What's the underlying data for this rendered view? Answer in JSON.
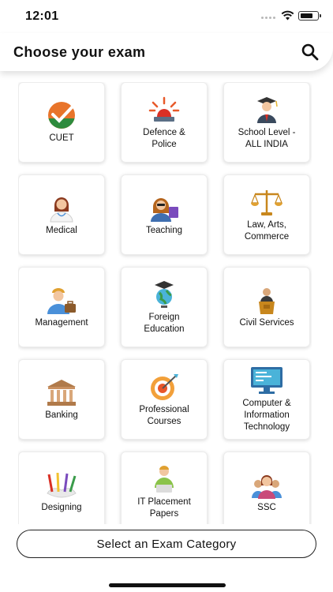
{
  "status_bar": {
    "time": "12:01"
  },
  "header": {
    "title": "Choose your exam",
    "search_icon": "search-icon"
  },
  "categories": [
    {
      "label": "CUET",
      "icon": "cuet-logo-icon"
    },
    {
      "label": "Defence &\nPolice",
      "icon": "siren-icon"
    },
    {
      "label": "School Level -\nALL INDIA",
      "icon": "graduate-icon"
    },
    {
      "label": "Medical",
      "icon": "doctor-icon"
    },
    {
      "label": "Teaching",
      "icon": "teacher-icon"
    },
    {
      "label": "Law, Arts,\nCommerce",
      "icon": "scales-icon"
    },
    {
      "label": "Management",
      "icon": "manager-icon"
    },
    {
      "label": "Foreign\nEducation",
      "icon": "globe-cap-icon"
    },
    {
      "label": "Civil Services",
      "icon": "podium-icon"
    },
    {
      "label": "Banking",
      "icon": "bank-icon"
    },
    {
      "label": "Professional\nCourses",
      "icon": "target-icon"
    },
    {
      "label": "Computer &\nInformation\nTechnology",
      "icon": "computer-icon"
    },
    {
      "label": "Designing",
      "icon": "paint-brushes-icon"
    },
    {
      "label": "IT Placement\nPapers",
      "icon": "it-professional-icon"
    },
    {
      "label": "SSC",
      "icon": "group-icon"
    }
  ],
  "footer": {
    "button_label": "Select an Exam Category"
  }
}
